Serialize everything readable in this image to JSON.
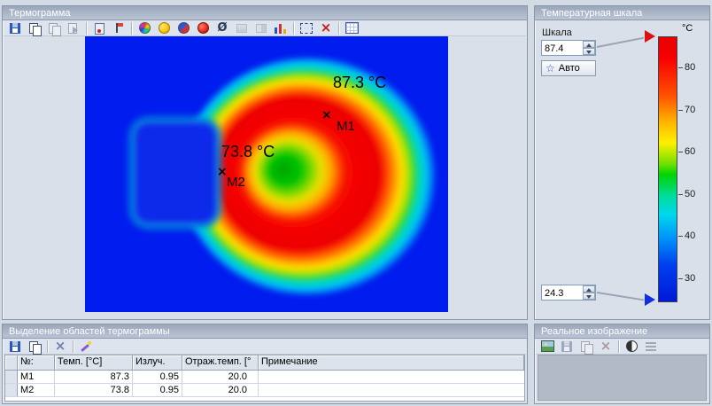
{
  "colors": {
    "titlebar_top": "#9aa6ba",
    "titlebar_bottom": "#bac4d4",
    "max_marker": "#dc1010",
    "min_marker": "#1030e0",
    "thermal_background": "#001cee"
  },
  "thermogram_panel": {
    "title": "Термограмма",
    "toolbar": [
      "save",
      "copy",
      "paste-disabled",
      "export-disabled",
      "|",
      "marker-temp",
      "marker-flag",
      "|",
      "palette",
      "circle-yellow",
      "palette-duo",
      "circle-red",
      "emissivity",
      "isotherm-disabled",
      "profile-disabled",
      "histogram",
      "|",
      "select-rect",
      "delete",
      "|",
      "grid"
    ],
    "markers": [
      {
        "id": "M1",
        "temp": "87.3 °C"
      },
      {
        "id": "M2",
        "temp": "73.8 °C"
      }
    ]
  },
  "scale_panel": {
    "title": "Температурная шкала",
    "scale_label": "Шкала",
    "max_value": "87.4",
    "min_value": "24.3",
    "auto_label": "Авто",
    "unit": "°C",
    "ticks": [
      {
        "label": "80"
      },
      {
        "label": "70"
      },
      {
        "label": "60"
      },
      {
        "label": "50"
      },
      {
        "label": "40"
      },
      {
        "label": "30"
      }
    ]
  },
  "regions_panel": {
    "title": "Выделение областей термограммы",
    "toolbar": [
      "save",
      "copy",
      "|",
      "delete-soft",
      "|",
      "wand"
    ],
    "table": {
      "headers": {
        "num": "№:",
        "temp": "Темп. [°C]",
        "emiss": "Излуч.",
        "refl": "Отраж.темп. [°",
        "note": "Примечание"
      },
      "rows": [
        {
          "num": "M1",
          "temp": "87.3",
          "emiss": "0.95",
          "refl": "20.0",
          "note": ""
        },
        {
          "num": "M2",
          "temp": "73.8",
          "emiss": "0.95",
          "refl": "20.0",
          "note": ""
        }
      ]
    }
  },
  "real_panel": {
    "title": "Реальное изображение",
    "toolbar": [
      "photo",
      "save-disabled",
      "copy-disabled",
      "delete-disabled",
      "|",
      "contrast",
      "adjust-disabled"
    ]
  }
}
